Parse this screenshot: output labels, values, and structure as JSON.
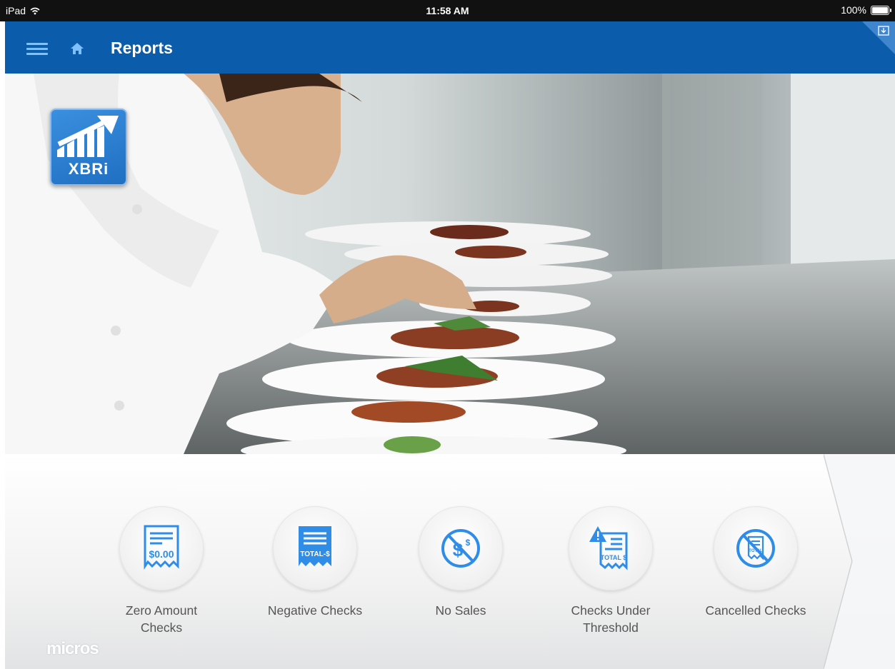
{
  "status_bar": {
    "device": "iPad",
    "time": "11:58 AM",
    "battery": "100%"
  },
  "header": {
    "title": "Reports"
  },
  "hero": {
    "logo_text": "XBRi"
  },
  "reports": [
    {
      "line1": "Zero Amount",
      "line2": "Checks",
      "icon": "zero-amount-receipt-icon",
      "icon_text": "$0.00"
    },
    {
      "line1": "Negative Checks",
      "line2": "",
      "icon": "negative-receipt-icon",
      "icon_text": "TOTAL-$"
    },
    {
      "line1": "No Sales",
      "line2": "",
      "icon": "no-sales-icon",
      "icon_text": "$"
    },
    {
      "line1": "Checks Under",
      "line2": "Threshold",
      "icon": "threshold-warning-icon",
      "icon_text": "TOTAL $"
    },
    {
      "line1": "Cancelled Checks",
      "line2": "",
      "icon": "cancelled-receipt-icon",
      "icon_text": "TOTAL"
    }
  ],
  "footer": {
    "brand": "micros"
  },
  "colors": {
    "header_blue": "#0b5cab",
    "icon_blue": "#2f8de8",
    "text_grey": "#555555"
  }
}
